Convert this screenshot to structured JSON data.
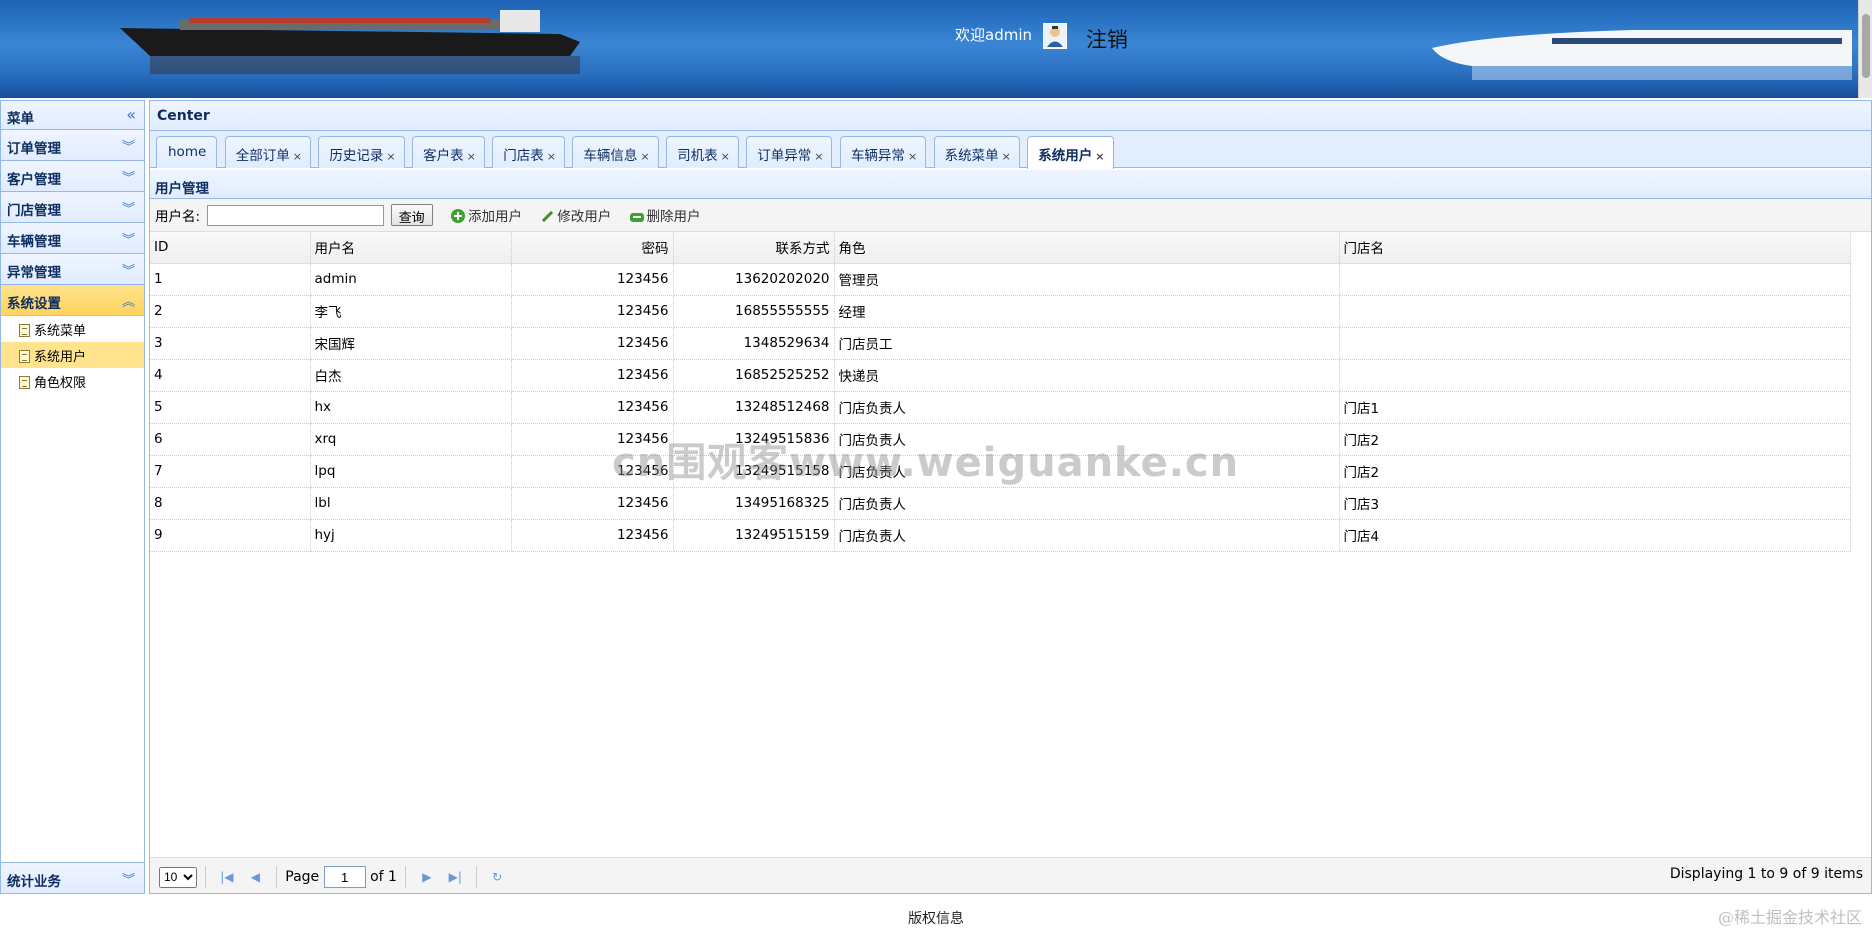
{
  "header": {
    "welcome_text": "欢迎admin",
    "logout_label": "注销"
  },
  "menu": {
    "title": "菜单",
    "sections": [
      {
        "label": "订单管理"
      },
      {
        "label": "客户管理"
      },
      {
        "label": "门店管理"
      },
      {
        "label": "车辆管理"
      },
      {
        "label": "异常管理"
      },
      {
        "label": "系统设置"
      }
    ],
    "system_items": [
      "系统菜单",
      "系统用户",
      "角色权限"
    ],
    "bottom_section": "统计业务"
  },
  "center": {
    "title": "Center",
    "tabs": [
      "home",
      "全部订单",
      "历史记录",
      "客户表",
      "门店表",
      "车辆信息",
      "司机表",
      "订单异常",
      "车辆异常",
      "系统菜单",
      "系统用户"
    ],
    "active_tab": "系统用户"
  },
  "panel": {
    "title": "用户管理",
    "search_label": "用户名:",
    "search_value": "",
    "query_button": "查询",
    "add_button": "添加用户",
    "edit_button": "修改用户",
    "delete_button": "删除用户"
  },
  "grid": {
    "columns": [
      "ID",
      "用户名",
      "密码",
      "联系方式",
      "角色",
      "门店名"
    ],
    "rows": [
      [
        "1",
        "admin",
        "123456",
        "13620202020",
        "管理员",
        ""
      ],
      [
        "2",
        "李飞",
        "123456",
        "16855555555",
        "经理",
        ""
      ],
      [
        "3",
        "宋国辉",
        "123456",
        "1348529634",
        "门店员工",
        ""
      ],
      [
        "4",
        "白杰",
        "123456",
        "16852525252",
        "快递员",
        ""
      ],
      [
        "5",
        "hx",
        "123456",
        "13248512468",
        "门店负责人",
        "门店1"
      ],
      [
        "6",
        "xrq",
        "123456",
        "13249515836",
        "门店负责人",
        "门店2"
      ],
      [
        "7",
        "lpq",
        "123456",
        "13249515158",
        "门店负责人",
        "门店2"
      ],
      [
        "8",
        "lbl",
        "123456",
        "13495168325",
        "门店负责人",
        "门店3"
      ],
      [
        "9",
        "hyj",
        "123456",
        "13249515159",
        "门店负责人",
        "门店4"
      ]
    ]
  },
  "pager": {
    "page_size": "10",
    "page_label": "Page",
    "page_value": "1",
    "of_label": "of 1",
    "info": "Displaying 1 to 9 of 9 items"
  },
  "footer": {
    "text": "版权信息",
    "watermark": "@稀土掘金技术社区",
    "overlay_watermark": "cn围观客www.weiguanke.cn"
  },
  "colors": {
    "accent_border": "#95b8e7",
    "selected_bg": "#ffe48d",
    "banner_blue": "#2a6fc0"
  }
}
